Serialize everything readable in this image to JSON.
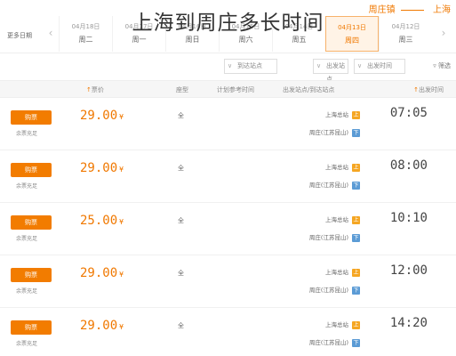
{
  "page_title": "上海到周庄多长时间",
  "route": {
    "from": "上海",
    "to": "周庄镇"
  },
  "calendar_label": "更多日期",
  "dates": [
    {
      "date": "04月18日",
      "weekday": "周二"
    },
    {
      "date": "04月17日",
      "weekday": "周一"
    },
    {
      "date": "04月16日",
      "weekday": "周日"
    },
    {
      "date": "04月15日",
      "weekday": "周六"
    },
    {
      "date": "04月14日",
      "weekday": "周五"
    },
    {
      "date": "04月13日",
      "weekday": "周四"
    },
    {
      "date": "04月12日",
      "weekday": "周三"
    }
  ],
  "filters": {
    "label": "筛选",
    "departure_time": "出发时间",
    "departure_station": "出发站点",
    "arrival_station": "到达站点"
  },
  "table_headers": {
    "departure_time": "出发时间",
    "stations": "出发站点/到达站点",
    "duration": "计划参考时间",
    "seat": "座型",
    "price": "票价"
  },
  "rows": [
    {
      "time": "07:05",
      "from": "上海总站",
      "to": "周庄(江苏昆山)",
      "seat": "全",
      "price": "29.00",
      "buy": "购票",
      "remain": "余票充足"
    },
    {
      "time": "08:00",
      "from": "上海总站",
      "to": "周庄(江苏昆山)",
      "seat": "全",
      "price": "29.00",
      "buy": "购票",
      "remain": "余票充足"
    },
    {
      "time": "10:10",
      "from": "上海总站",
      "to": "周庄(江苏昆山)",
      "seat": "全",
      "price": "25.00",
      "buy": "购票",
      "remain": "余票充足"
    },
    {
      "time": "12:00",
      "from": "上海总站",
      "to": "周庄(江苏昆山)",
      "seat": "全",
      "price": "29.00",
      "buy": "购票",
      "remain": "余票充足"
    },
    {
      "time": "14:20",
      "from": "上海总站",
      "to": "周庄(江苏昆山)",
      "seat": "全",
      "price": "29.00",
      "buy": "购票",
      "remain": "余票充足"
    }
  ],
  "currency": "¥",
  "badges": {
    "from": "上",
    "to": "下"
  },
  "accent_color": "#f07800"
}
